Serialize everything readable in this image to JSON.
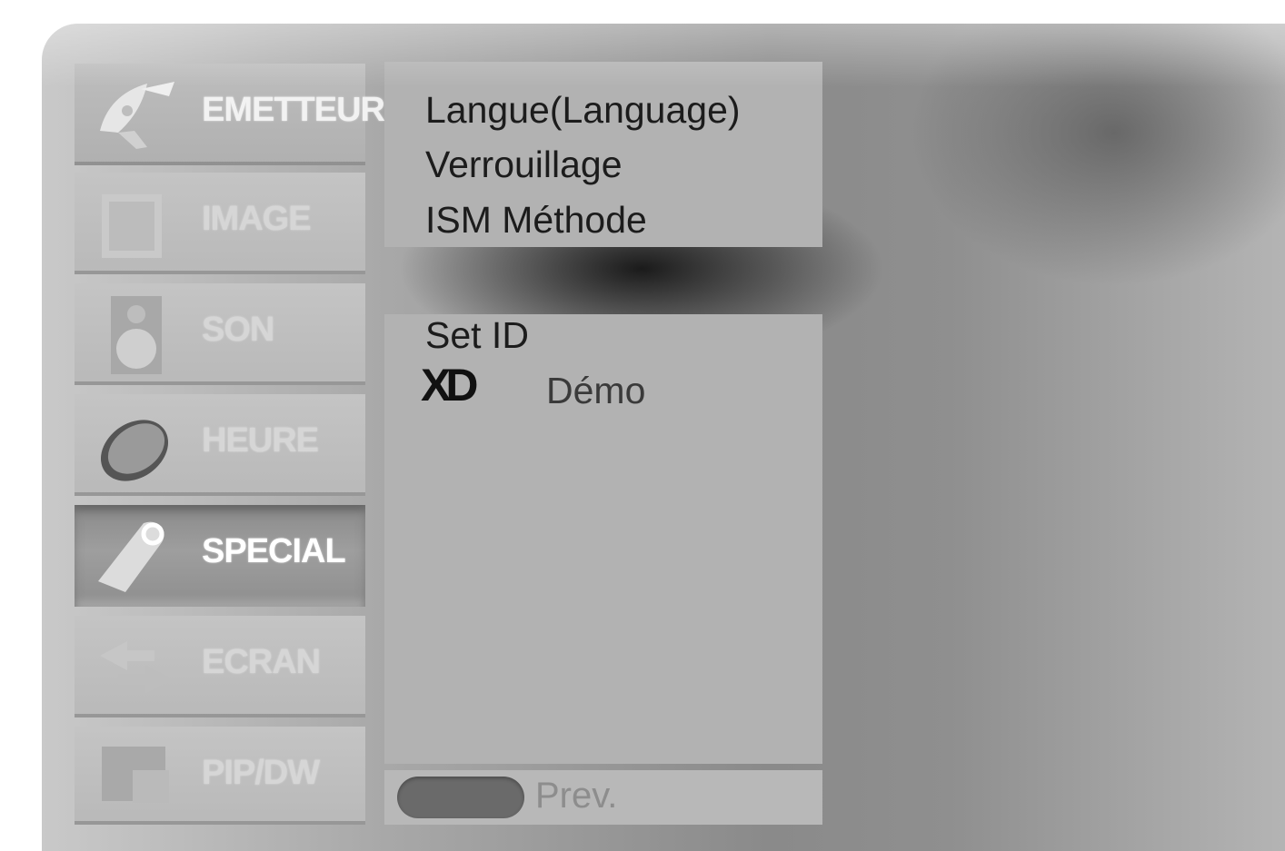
{
  "sidebar": {
    "items": [
      {
        "id": "emetteur",
        "label": "EMETTEUR",
        "icon": "satellite-dish-icon",
        "state": "normal"
      },
      {
        "id": "image",
        "label": "IMAGE",
        "icon": "picture-icon",
        "state": "faded"
      },
      {
        "id": "son",
        "label": "SON",
        "icon": "speaker-icon",
        "state": "faded"
      },
      {
        "id": "heure",
        "label": "HEURE",
        "icon": "clock-icon",
        "state": "faded"
      },
      {
        "id": "special",
        "label": "SPECIAL",
        "icon": "tag-icon",
        "state": "selected"
      },
      {
        "id": "ecran",
        "label": "ECRAN",
        "icon": "arrows-icon",
        "state": "faded"
      },
      {
        "id": "pip",
        "label": "PIP/DW",
        "icon": "pip-icon",
        "state": "faded"
      }
    ]
  },
  "submenu": {
    "group1": [
      "Langue(Language)",
      "Verrouillage",
      "ISM Méthode"
    ],
    "group2": {
      "set_id": "Set ID",
      "xd_logo": "XD",
      "demo": "Démo"
    }
  },
  "footer": {
    "prev_label": "Prev."
  },
  "colors": {
    "panel": "#b2b2b2",
    "selected_item": "#949494",
    "menu_text": "#1c1c1c"
  }
}
